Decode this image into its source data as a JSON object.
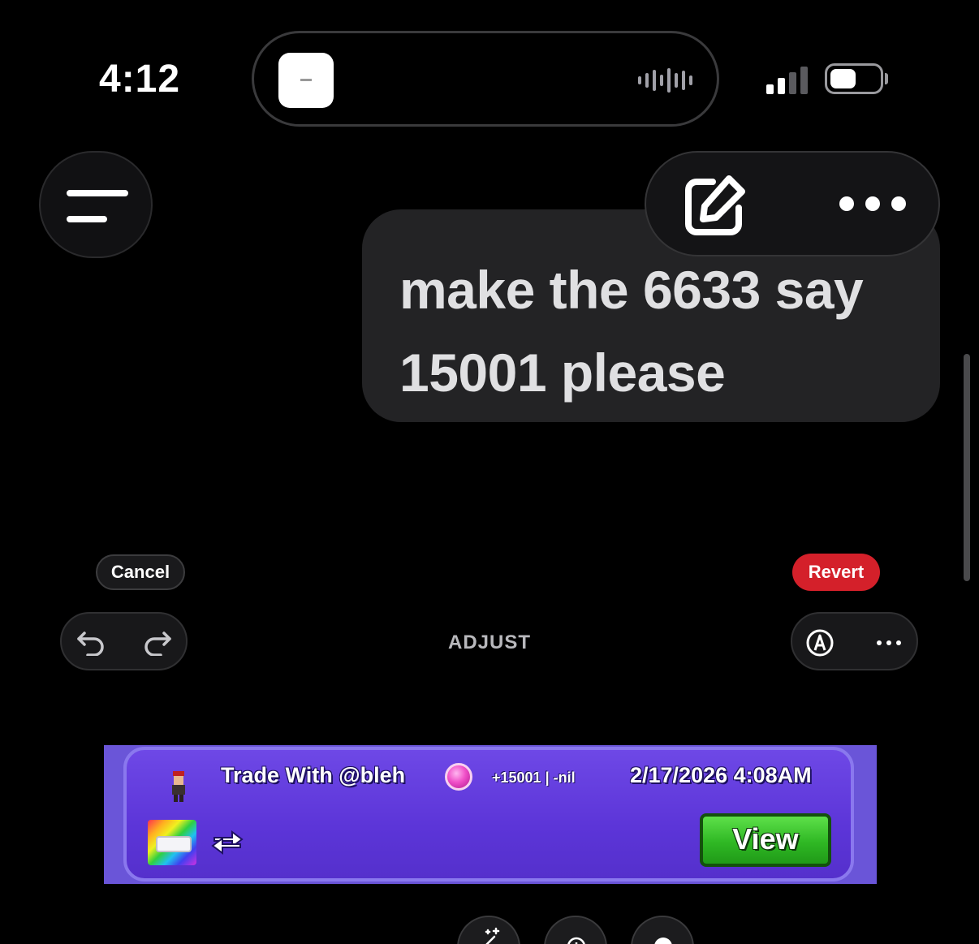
{
  "status_bar": {
    "time": "4:12",
    "signal_bars": 4,
    "battery_level": 0.5
  },
  "header": {
    "menu_icon": "hamburger-menu-icon",
    "edit_icon": "compose-icon",
    "more_icon": "ellipsis-icon"
  },
  "message": {
    "text": "make the 6633 say 15001 please"
  },
  "editor": {
    "cancel_label": "Cancel",
    "revert_label": "Revert",
    "mode_label": "ADJUST",
    "undo_icon": "undo-icon",
    "redo_icon": "redo-icon",
    "markup_icon": "markup-pen-icon",
    "more_icon": "ellipsis-icon",
    "accent_color": "#d4202a"
  },
  "trade_banner": {
    "title": "Trade With @bleh",
    "value_change": "+15001 | -nil",
    "timestamp": "2/17/2026 4:08AM",
    "view_label": "View",
    "button_color": "#2fb824",
    "background_color": "#6a55d8"
  },
  "bottom_tools": [
    {
      "icon": "magic-wand-icon"
    },
    {
      "icon": "exposure-icon"
    },
    {
      "icon": "brilliance-icon"
    }
  ]
}
